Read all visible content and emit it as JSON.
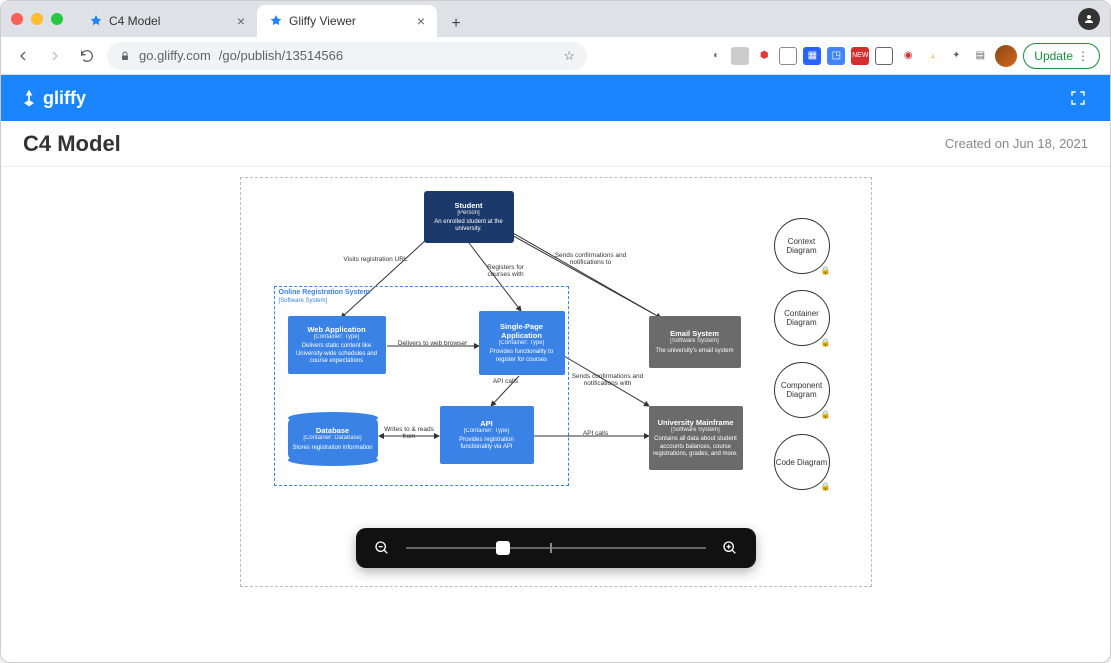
{
  "browser": {
    "tabs": [
      {
        "title": "C4 Model",
        "active": false
      },
      {
        "title": "Gliffy Viewer",
        "active": true
      }
    ],
    "url_host": "go.gliffy.com",
    "url_path": "/go/publish/13514566",
    "update_label": "Update"
  },
  "app": {
    "brand": "gliffy",
    "doc_title": "C4 Model",
    "created_label": "Created on Jun 18, 2021"
  },
  "diagram": {
    "boundary": {
      "title": "Online Registration System",
      "subtitle": "[Software System]"
    },
    "nodes": {
      "student": {
        "title": "Student",
        "type": "[Person]",
        "desc": "An enrolled student at the university."
      },
      "web": {
        "title": "Web Application",
        "type": "[Container: Type]",
        "desc": "Delivers static content like University-wide schedules and course expectations"
      },
      "spa": {
        "title": "Single-Page Application",
        "type": "[Container: Type]",
        "desc": "Provides functionality to register for courses"
      },
      "api": {
        "title": "API",
        "type": "[Container: Type]",
        "desc": "Provides registration functionality via API"
      },
      "db": {
        "title": "Database",
        "type": "[Container: Database]",
        "desc": "Stores registration information"
      },
      "email": {
        "title": "Email System",
        "type": "[Software System]",
        "desc": "The university's email system"
      },
      "mainframe": {
        "title": "University Mainframe",
        "type": "[Software System]",
        "desc": "Contains all data about student accounts balances, course registrations, grades, and more."
      }
    },
    "edges": {
      "visits": "Visits registration URL",
      "registers": "Registers for courses with",
      "sends1": "Sends confirmations and notifications to",
      "delivers": "Delivers to web browser",
      "apicalls1": "API calls",
      "sends2": "Sends confirmations and notifications with",
      "writes": "Writes to & reads from",
      "apicalls2": "API calls"
    },
    "nav_circles": {
      "context": "Context Diagram",
      "container": "Container Diagram",
      "component": "Component Diagram",
      "code": "Code Diagram"
    }
  }
}
